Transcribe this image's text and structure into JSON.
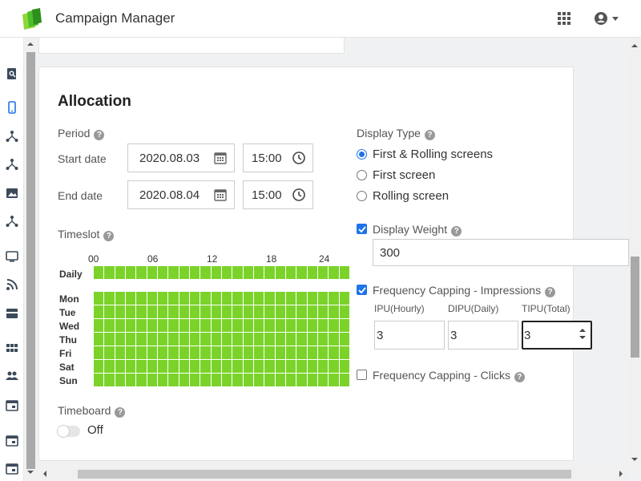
{
  "app": {
    "title": "Campaign Manager",
    "brand_color": "#4bbf2a"
  },
  "header": {
    "apps_icon": "apps-grid-icon",
    "user_icon": "user-circle-icon"
  },
  "sidebar": {
    "icons": [
      "search-doc-icon",
      "mobile-icon",
      "network-icon",
      "network-icon",
      "image-icon",
      "network-icon",
      "monitor-icon",
      "rss-icon",
      "card-icon",
      "grid-icon",
      "users-icon",
      "calendar-icon",
      "calendar-icon",
      "calendar-icon"
    ]
  },
  "allocation": {
    "title": "Allocation",
    "period_label": "Period",
    "start_label": "Start date",
    "start_date": "2020.08.03",
    "start_time": "15:00",
    "end_label": "End date",
    "end_date": "2020.08.04",
    "end_time": "15:00",
    "timeslot_label": "Timeslot",
    "hours": [
      "00",
      "06",
      "12",
      "18",
      "24"
    ],
    "daily_label": "Daily",
    "days": [
      "Mon",
      "Tue",
      "Wed",
      "Thu",
      "Fri",
      "Sat",
      "Sun"
    ],
    "slot_color": "#7bd32a",
    "timeboard_label": "Timeboard",
    "timeboard_state": "Off",
    "display_type_label": "Display Type",
    "display_types": [
      "First & Rolling screens",
      "First screen",
      "Rolling screen"
    ],
    "display_type_selected": "First & Rolling screens",
    "display_weight_label": "Display Weight",
    "display_weight": "300",
    "freq_impr_label": "Frequency Capping - Impressions",
    "ipu_label": "IPU(Hourly)",
    "ipu": "3",
    "dipu_label": "DIPU(Daily)",
    "dipu": "3",
    "tipu_label": "TIPU(Total)",
    "tipu": "3",
    "freq_clicks_label": "Frequency Capping - Clicks",
    "accent_color": "#1e74e8"
  }
}
